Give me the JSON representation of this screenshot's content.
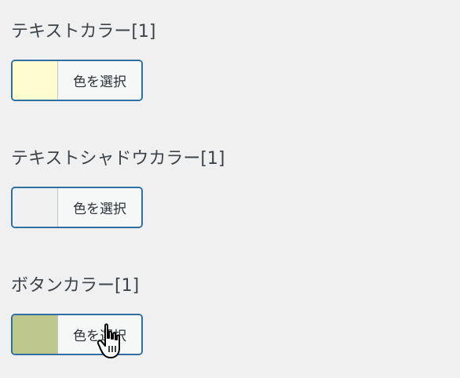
{
  "sections": [
    {
      "title": "テキストカラー[1]",
      "button_label": "色を選択",
      "swatch_color": "#fffdd0"
    },
    {
      "title": "テキストシャドウカラー[1]",
      "button_label": "色を選択",
      "swatch_color": "#f0f0f1"
    },
    {
      "title": "ボタンカラー[1]",
      "button_label": "色を選択",
      "swatch_color": "#bec78c"
    }
  ],
  "cursor": {
    "icon": "hand-pointer-icon"
  }
}
